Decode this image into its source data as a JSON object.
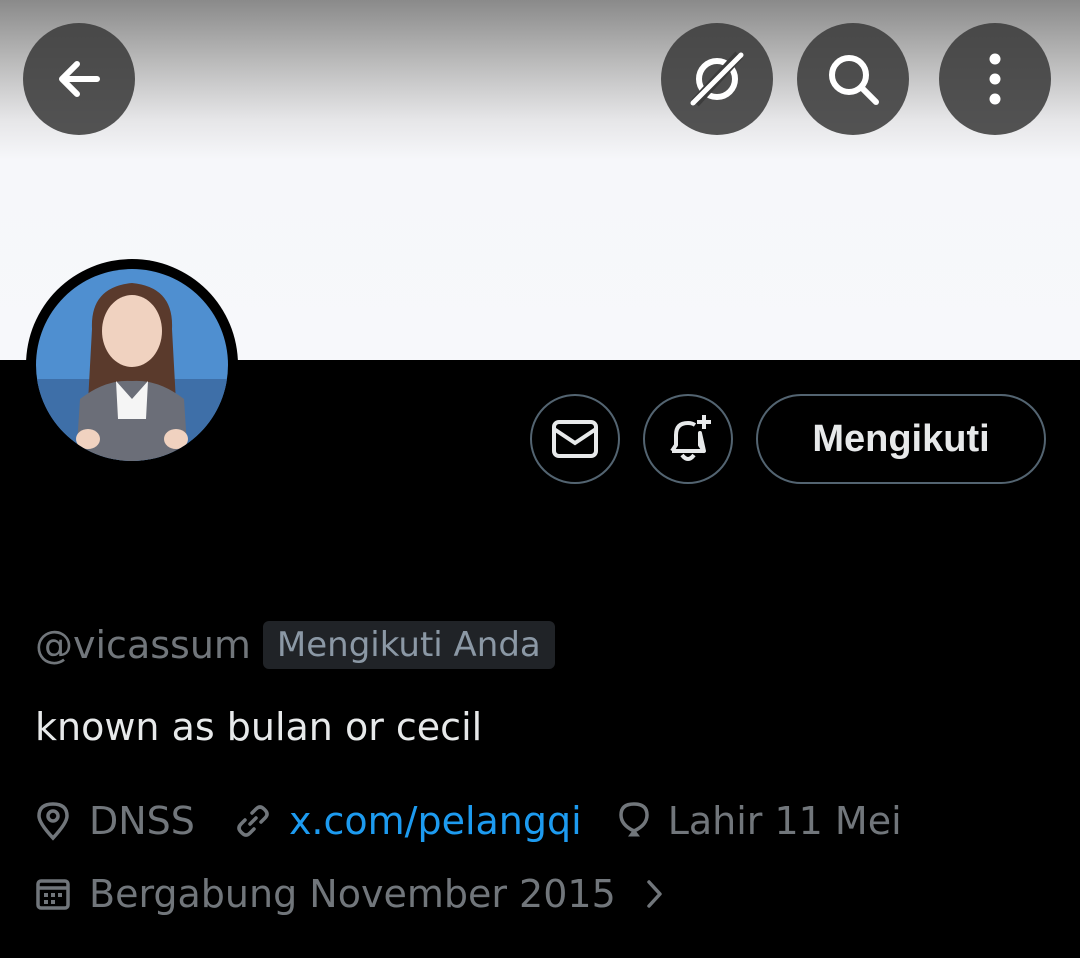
{
  "profile": {
    "handle": "@vicassum",
    "follows_you_badge": "Mengikuti Anda",
    "bio": "known as bulan or cecil",
    "location": "DNSS",
    "website": "x.com/pelangqi",
    "birthday": "Lahir 11 Mei",
    "joined": "Bergabung November 2015"
  },
  "actions": {
    "follow_label": "Mengikuti"
  },
  "icons": {
    "back": "arrow-left-icon",
    "grok": "grok-icon",
    "search": "search-icon",
    "more": "more-vertical-icon",
    "message": "envelope-icon",
    "notify": "bell-plus-icon",
    "location": "map-pin-icon",
    "website": "link-icon",
    "birthday": "balloon-icon",
    "joined": "calendar-icon",
    "chevron": "chevron-right-icon"
  },
  "colors": {
    "background": "#000000",
    "link": "#1d9bf0",
    "muted_text": "#71767b",
    "border": "#536471"
  }
}
